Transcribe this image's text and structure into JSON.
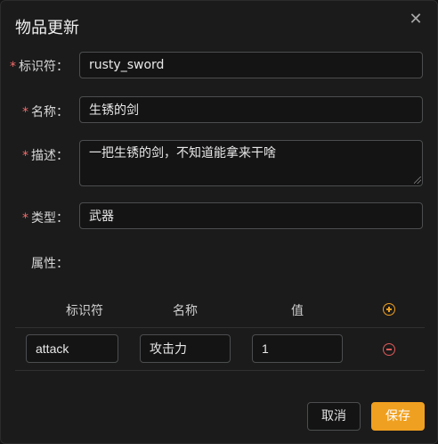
{
  "dialog": {
    "title": "物品更新",
    "close_glyph": "✕"
  },
  "form": {
    "id_label": "标识符：",
    "id_value": "rusty_sword",
    "name_label": "名称：",
    "name_value": "生锈的剑",
    "desc_label": "描述：",
    "desc_value": "一把生锈的剑，不知道能拿来干啥",
    "type_label": "类型：",
    "type_value": "武器",
    "attr_label": "属性：",
    "required_mark": "*"
  },
  "attributes": {
    "columns": [
      "标识符",
      "名称",
      "值"
    ],
    "rows": [
      {
        "id": "attack",
        "name": "攻击力",
        "value": "1"
      }
    ]
  },
  "footer": {
    "cancel_label": "取消",
    "save_label": "保存"
  },
  "colors": {
    "accent": "#f0a020",
    "required": "#f56c6c",
    "remove": "#e05a5a"
  }
}
